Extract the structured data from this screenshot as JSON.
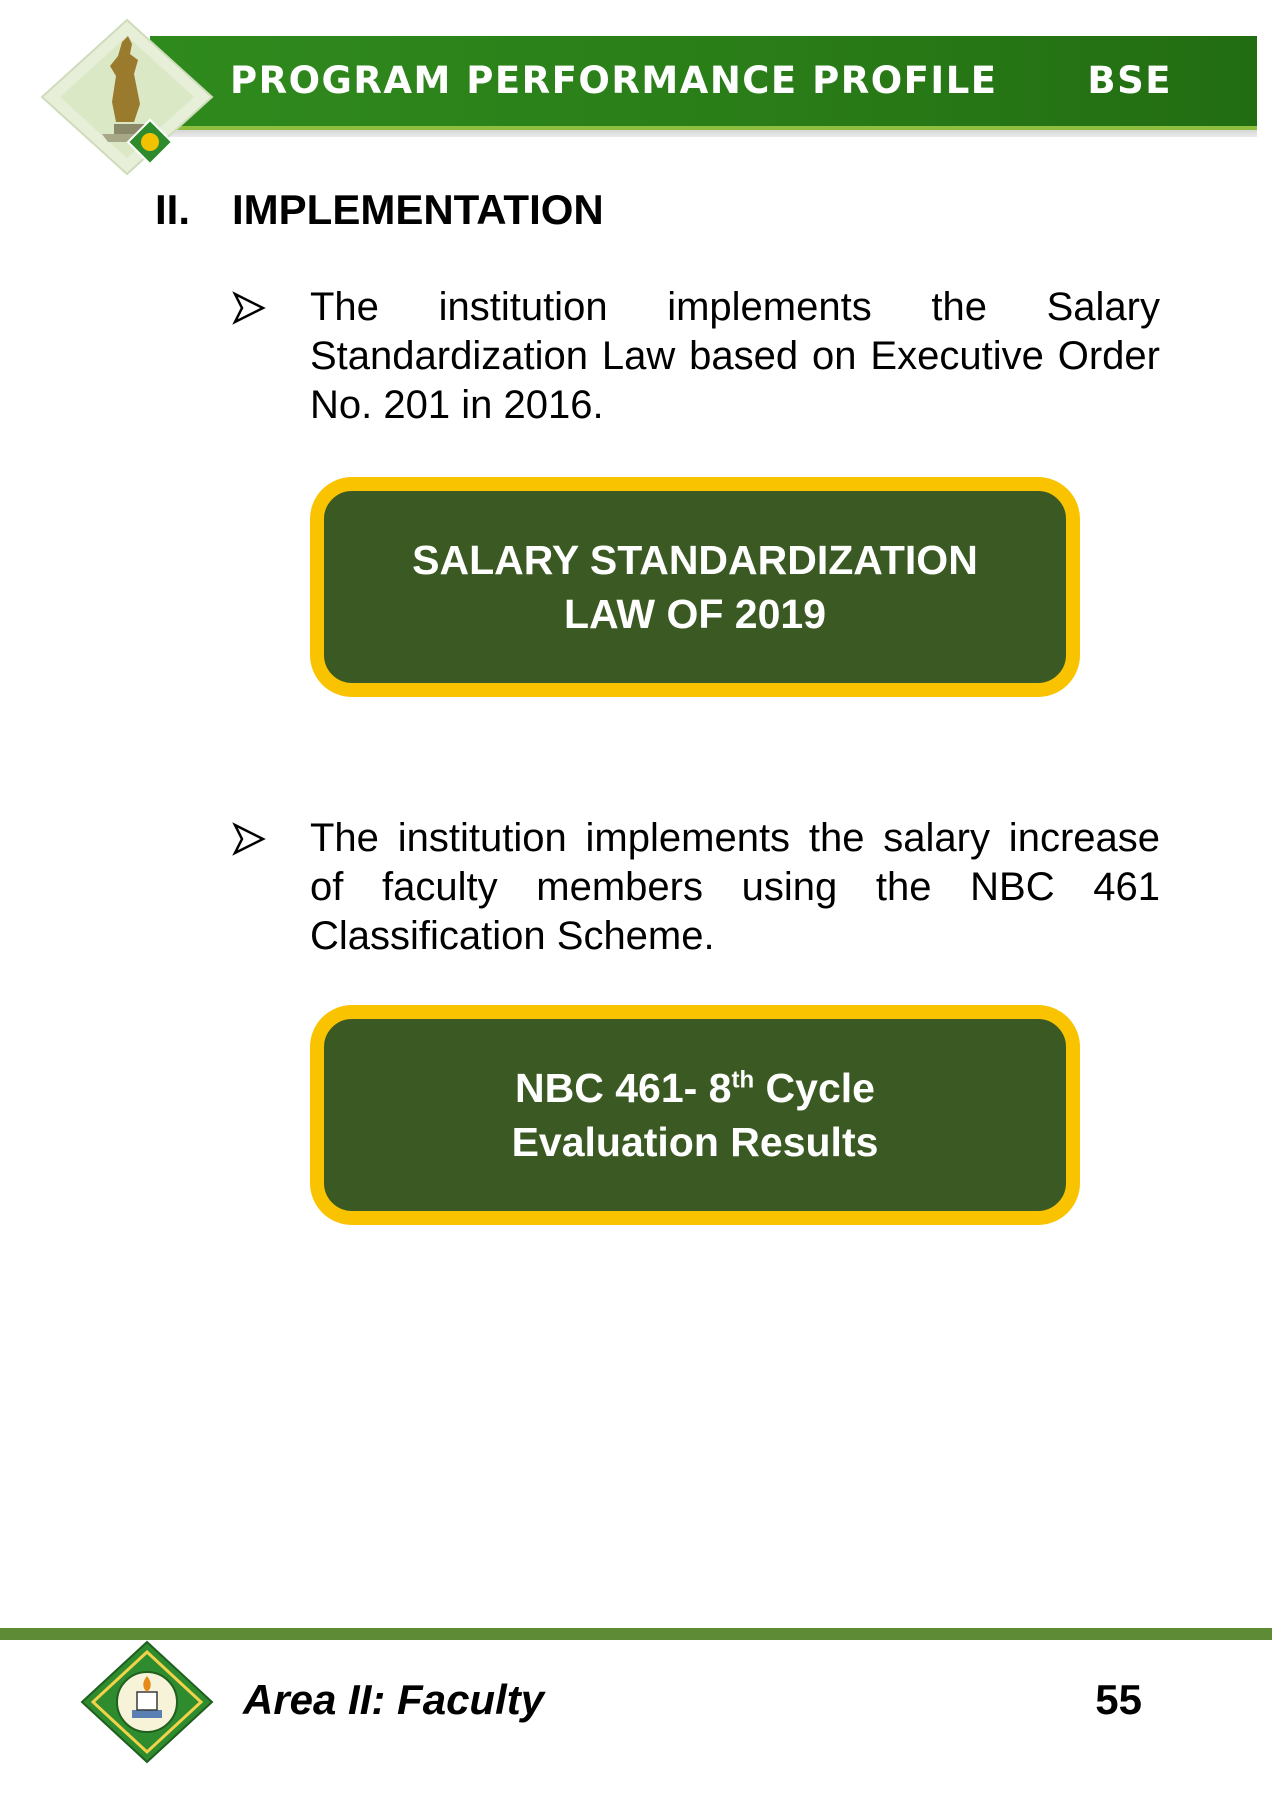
{
  "header": {
    "title": "PROGRAM PERFORMANCE PROFILE",
    "program_code": "BSE"
  },
  "section": {
    "number": "II.",
    "title": "IMPLEMENTATION"
  },
  "items": [
    {
      "text": "The institution implements the Salary Standardization Law based on Executive Order No. 201 in 2016.",
      "callout": {
        "line1": "SALARY STANDARDIZATION",
        "line2": "LAW OF 2019"
      }
    },
    {
      "text": "The institution implements the salary increase of faculty members using the NBC 461 Classification Scheme.",
      "callout": {
        "line1_pre": "NBC 461- 8",
        "line1_sup": "th",
        "line1_post": " Cycle",
        "line2": "Evaluation Results"
      }
    }
  ],
  "footer": {
    "area": "Area II: Faculty",
    "page_number": "55"
  },
  "colors": {
    "header_green": "#2a7d18",
    "callout_fill": "#3b5a23",
    "callout_border": "#f9c300",
    "footer_rule": "#5e8c36"
  },
  "icons": {
    "header_emblem": "statue-seal-emblem-icon",
    "bullet": "arrow-bullet-icon",
    "footer_emblem": "university-seal-icon"
  }
}
